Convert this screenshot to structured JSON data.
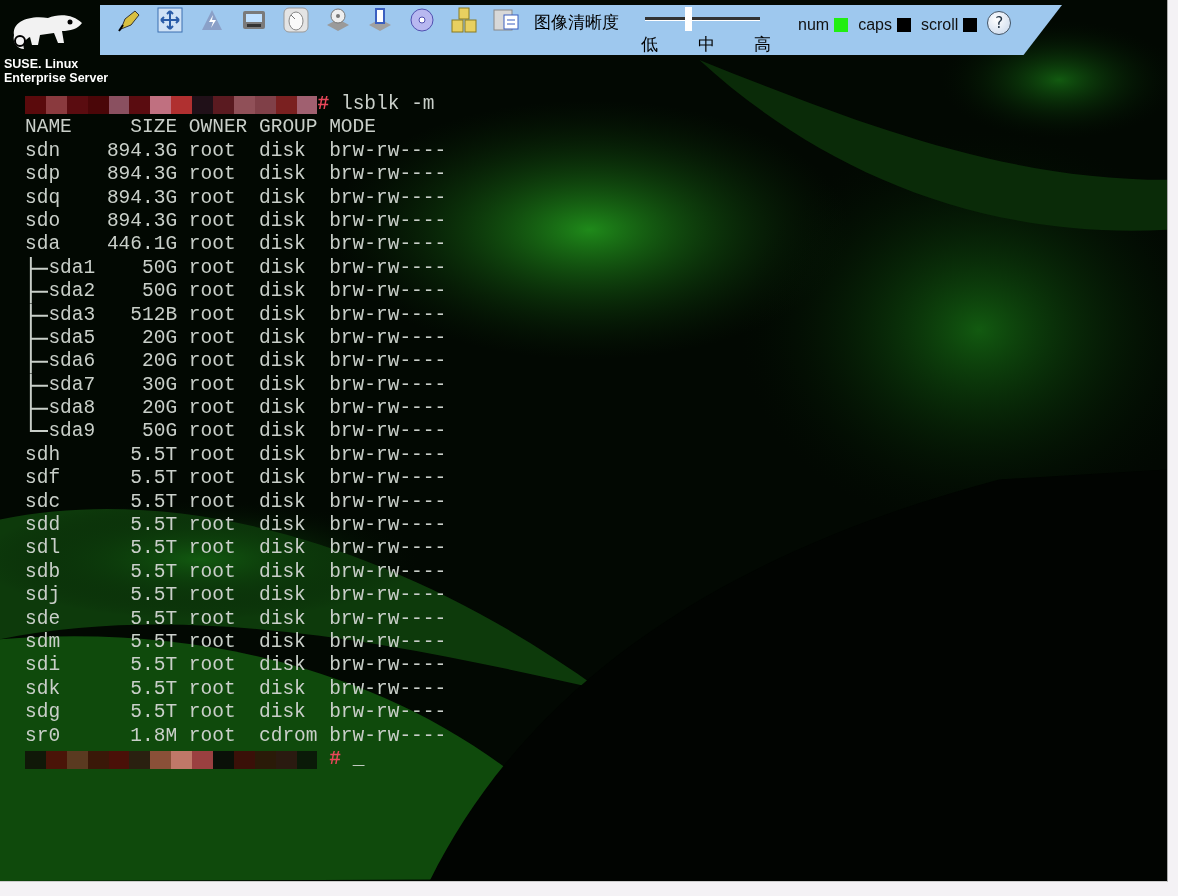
{
  "branding": {
    "line_1": "SUSE. Linux",
    "line_2": "Enterprise Server"
  },
  "toolbar": {
    "quality_label": "图像清晰度",
    "slider": {
      "level": 0.37,
      "ticks": [
        "低",
        "中",
        "高"
      ]
    },
    "indicators": [
      {
        "label": "num",
        "on": true
      },
      {
        "label": "caps",
        "on": false
      },
      {
        "label": "scroll",
        "on": false
      }
    ],
    "help": "?"
  },
  "terminal": {
    "command_line": {
      "prompt": "#",
      "command": "lsblk -m"
    },
    "header": [
      "NAME",
      "SIZE",
      "OWNER",
      "GROUP",
      "MODE"
    ],
    "rows": [
      {
        "name": "sdn",
        "size": "894.3G",
        "owner": "root",
        "group": "disk",
        "mode": "brw-rw----"
      },
      {
        "name": "sdp",
        "size": "894.3G",
        "owner": "root",
        "group": "disk",
        "mode": "brw-rw----"
      },
      {
        "name": "sdq",
        "size": "894.3G",
        "owner": "root",
        "group": "disk",
        "mode": "brw-rw----"
      },
      {
        "name": "sdo",
        "size": "894.3G",
        "owner": "root",
        "group": "disk",
        "mode": "brw-rw----"
      },
      {
        "name": "sda",
        "size": "446.1G",
        "owner": "root",
        "group": "disk",
        "mode": "brw-rw----",
        "children": [
          {
            "name": "sda1",
            "size": "50G",
            "owner": "root",
            "group": "disk",
            "mode": "brw-rw----"
          },
          {
            "name": "sda2",
            "size": "50G",
            "owner": "root",
            "group": "disk",
            "mode": "brw-rw----"
          },
          {
            "name": "sda3",
            "size": "512B",
            "owner": "root",
            "group": "disk",
            "mode": "brw-rw----"
          },
          {
            "name": "sda5",
            "size": "20G",
            "owner": "root",
            "group": "disk",
            "mode": "brw-rw----"
          },
          {
            "name": "sda6",
            "size": "20G",
            "owner": "root",
            "group": "disk",
            "mode": "brw-rw----"
          },
          {
            "name": "sda7",
            "size": "30G",
            "owner": "root",
            "group": "disk",
            "mode": "brw-rw----"
          },
          {
            "name": "sda8",
            "size": "20G",
            "owner": "root",
            "group": "disk",
            "mode": "brw-rw----"
          },
          {
            "name": "sda9",
            "size": "50G",
            "owner": "root",
            "group": "disk",
            "mode": "brw-rw----"
          }
        ]
      },
      {
        "name": "sdh",
        "size": "5.5T",
        "owner": "root",
        "group": "disk",
        "mode": "brw-rw----"
      },
      {
        "name": "sdf",
        "size": "5.5T",
        "owner": "root",
        "group": "disk",
        "mode": "brw-rw----"
      },
      {
        "name": "sdc",
        "size": "5.5T",
        "owner": "root",
        "group": "disk",
        "mode": "brw-rw----"
      },
      {
        "name": "sdd",
        "size": "5.5T",
        "owner": "root",
        "group": "disk",
        "mode": "brw-rw----"
      },
      {
        "name": "sdl",
        "size": "5.5T",
        "owner": "root",
        "group": "disk",
        "mode": "brw-rw----"
      },
      {
        "name": "sdb",
        "size": "5.5T",
        "owner": "root",
        "group": "disk",
        "mode": "brw-rw----"
      },
      {
        "name": "sdj",
        "size": "5.5T",
        "owner": "root",
        "group": "disk",
        "mode": "brw-rw----"
      },
      {
        "name": "sde",
        "size": "5.5T",
        "owner": "root",
        "group": "disk",
        "mode": "brw-rw----"
      },
      {
        "name": "sdm",
        "size": "5.5T",
        "owner": "root",
        "group": "disk",
        "mode": "brw-rw----"
      },
      {
        "name": "sdi",
        "size": "5.5T",
        "owner": "root",
        "group": "disk",
        "mode": "brw-rw----"
      },
      {
        "name": "sdk",
        "size": "5.5T",
        "owner": "root",
        "group": "disk",
        "mode": "brw-rw----"
      },
      {
        "name": "sdg",
        "size": "5.5T",
        "owner": "root",
        "group": "disk",
        "mode": "brw-rw----"
      },
      {
        "name": "sr0",
        "size": "1.8M",
        "owner": "root",
        "group": "cdrom",
        "mode": "brw-rw----"
      }
    ],
    "final_prompt": {
      "prompt": "#",
      "cursor": "_"
    }
  }
}
